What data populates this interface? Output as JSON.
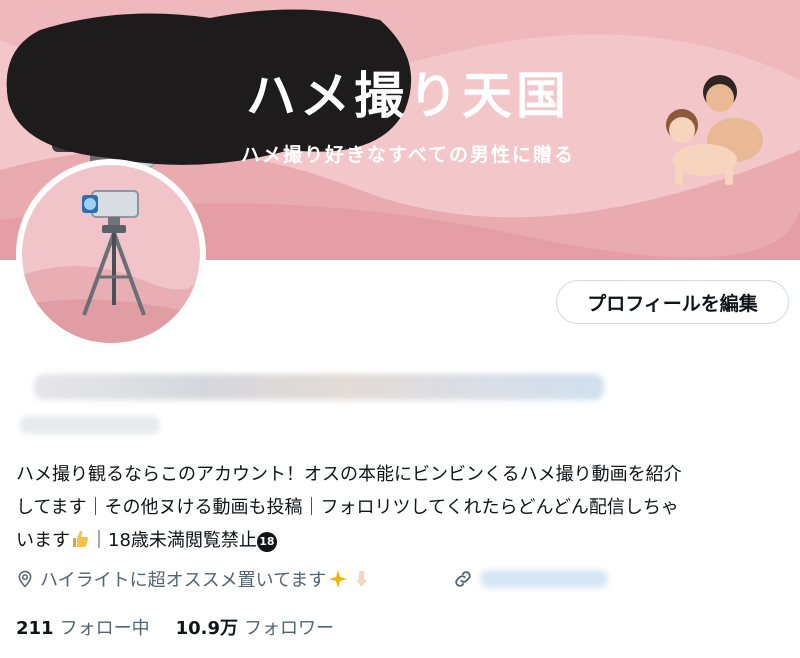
{
  "banner": {
    "title": "ハメ撮り天国",
    "subtitle": "ハメ撮り好きなすべての男性に贈る"
  },
  "profile": {
    "edit_button_label": "プロフィールを編集",
    "bio_line1": "ハメ撮り観るならこのアカウント！オスの本能にビンビンくるハメ撮り動画を紹介",
    "bio_line2": "してます｜その他ヌける動画も投稿｜フォロリツしてくれたらどんどん配信しちゃ",
    "bio_line3_a": "います",
    "bio_line3_b": "｜18歳未満閲覧禁止",
    "age_badge": "18",
    "location": "ハイライトに超オススメ置いてます",
    "following_count": "211",
    "following_label": "フォロー中",
    "followers_count": "10.9万",
    "followers_label": "フォロワー"
  },
  "icons": [
    "location-pin-icon",
    "link-icon",
    "thumbs-up-icon",
    "sparkles-icon",
    "pointing-down-icon",
    "camera-tripod-icon"
  ],
  "colors": {
    "banner_bg": "#f3c6c9",
    "blob": "#1d1b1c",
    "meta_text": "#536471",
    "primary_text": "#0f1419"
  }
}
